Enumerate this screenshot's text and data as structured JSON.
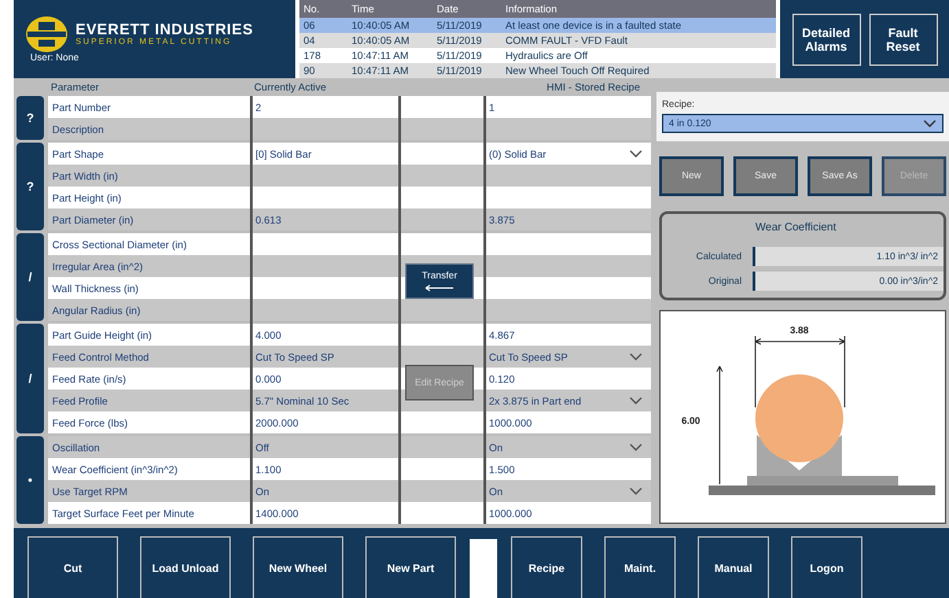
{
  "logo": {
    "company": "EVERETT INDUSTRIES",
    "tagline": "SUPERIOR METAL CUTTING",
    "user": "User: None"
  },
  "alarms": {
    "columns": [
      "No.",
      "Time",
      "Date",
      "Information"
    ],
    "rows": [
      {
        "cells": [
          "06",
          "10:40:05 AM",
          "5/11/2019",
          "At least one device is in a faulted state"
        ],
        "selected": true
      },
      {
        "cells": [
          "04",
          "10:40:05 AM",
          "5/11/2019",
          "COMM FAULT - VFD Fault"
        ],
        "selected": false
      },
      {
        "cells": [
          "178",
          "10:47:11 AM",
          "5/11/2019",
          "Hydraulics are Off"
        ],
        "selected": false
      },
      {
        "cells": [
          "90",
          "10:47:11 AM",
          "5/11/2019",
          "New Wheel Touch Off Required"
        ],
        "selected": false
      }
    ]
  },
  "header_buttons": [
    "Detailed Alarms",
    "Fault Reset"
  ],
  "table": {
    "columns": [
      "Parameter",
      "Currently Active",
      "HMI - Stored Recipe"
    ],
    "groups": [
      {
        "tab": "?",
        "rows": [
          {
            "name": "Part Number",
            "active": "2",
            "stored": "1",
            "dropdown": false
          },
          {
            "name": "Description",
            "active": "",
            "stored": "",
            "dropdown": false
          }
        ]
      },
      {
        "tab": "?",
        "rows": [
          {
            "name": "Part Shape",
            "active": "[0] Solid Bar",
            "stored": "(0) Solid Bar",
            "dropdown": true
          },
          {
            "name": "Part Width (in)",
            "active": "",
            "stored": "",
            "dropdown": false
          },
          {
            "name": "Part Height (in)",
            "active": "",
            "stored": "",
            "dropdown": false
          },
          {
            "name": "Part Diameter (in)",
            "active": "0.613",
            "stored": "3.875",
            "dropdown": false
          }
        ]
      },
      {
        "tab": "/",
        "rows": [
          {
            "name": "Cross Sectional Diameter (in)",
            "active": "",
            "stored": "",
            "dropdown": false
          },
          {
            "name": "Irregular Area (in^2)",
            "active": "",
            "stored": "",
            "dropdown": false
          },
          {
            "name": "Wall Thickness (in)",
            "active": "",
            "stored": "",
            "dropdown": false
          },
          {
            "name": "Angular Radius (in)",
            "active": "",
            "stored": "",
            "dropdown": false
          }
        ]
      },
      {
        "tab": "/",
        "rows": [
          {
            "name": "Part Guide Height (in)",
            "active": "4.000",
            "stored": "4.867",
            "dropdown": false
          },
          {
            "name": "Feed Control Method",
            "active": "Cut To Speed SP",
            "stored": "Cut To Speed SP",
            "dropdown": true
          },
          {
            "name": "Feed Rate (in/s)",
            "active": "0.000",
            "stored": "0.120",
            "dropdown": false
          },
          {
            "name": "Feed Profile",
            "active": "5.7\" Nominal 10 Sec",
            "stored": "2x 3.875 in Part end",
            "dropdown": true
          },
          {
            "name": "Feed Force (lbs)",
            "active": "2000.000",
            "stored": "1000.000",
            "dropdown": false
          }
        ]
      },
      {
        "tab": "•",
        "rows": [
          {
            "name": "Oscillation",
            "active": "Off",
            "stored": "On",
            "dropdown": true
          },
          {
            "name": "Wear Coefficient (in^3/in^2)",
            "active": "1.100",
            "stored": "1.500",
            "dropdown": false
          },
          {
            "name": "Use Target RPM",
            "active": "On",
            "stored": "On",
            "dropdown": true
          },
          {
            "name": "Target Surface Feet per Minute",
            "active": "1400.000",
            "stored": "1000.000",
            "dropdown": false
          }
        ]
      }
    ],
    "transfer_button": {
      "label": "Transfer",
      "disabled": false
    },
    "edit_button": {
      "label": "Edit Recipe",
      "disabled": true
    }
  },
  "recipe": {
    "label": "Recipe:",
    "value": "4 in 0.120"
  },
  "recipe_buttons": [
    {
      "label": "New",
      "disabled": false
    },
    {
      "label": "Save",
      "disabled": false
    },
    {
      "label": "Save As",
      "disabled": false
    },
    {
      "label": "Delete",
      "disabled": true
    }
  ],
  "wear": {
    "title": "Wear Coefficient",
    "rows": [
      {
        "label": "Calculated",
        "value": "1.10 in^3/ in^2"
      },
      {
        "label": "Original",
        "value": "0.00 in^3/in^2"
      }
    ]
  },
  "diagram": {
    "width_label": "3.88",
    "height_label": "6.00"
  },
  "bottom_left": [
    "Cut",
    "Load Unload",
    "New Wheel",
    "New Part"
  ],
  "bottom_right": [
    "Recipe",
    "Maint.",
    "Manual",
    "Logon"
  ]
}
